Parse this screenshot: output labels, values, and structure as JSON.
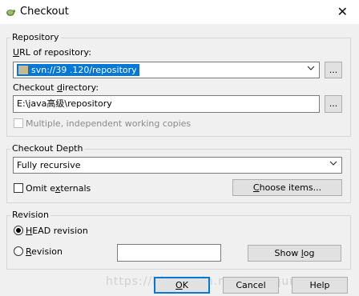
{
  "window": {
    "title": "Checkout",
    "close_glyph": "✕"
  },
  "repository": {
    "group_label": "Repository",
    "url_label_pre": "",
    "url_label_accel": "U",
    "url_label_post": "RL of repository:",
    "url_value": "svn://39            .120/repository",
    "checkout_label_pre": "Checkout ",
    "checkout_label_accel": "d",
    "checkout_label_post": "irectory:",
    "checkout_value": "E:\\java高级\\repository",
    "browse_label": "...",
    "multiple_label": "Multiple, independent working copies"
  },
  "depth": {
    "group_label": "Checkout Depth",
    "value": "Fully recursive",
    "omit_pre": "Omit e",
    "omit_accel": "x",
    "omit_post": "ternals",
    "choose_pre": "",
    "choose_accel": "C",
    "choose_post": "hoose items..."
  },
  "revision": {
    "group_label": "Revision",
    "head_accel": "H",
    "head_post": "EAD revision",
    "rev_accel": "R",
    "rev_post": "evision",
    "rev_value": "",
    "showlog_pre": "Show ",
    "showlog_accel": "l",
    "showlog_post": "og"
  },
  "buttons": {
    "ok_accel": "O",
    "ok_post": "K",
    "cancel": "Cancel",
    "help": "Help"
  },
  "watermark": "https://blog.csdn.net/zengqunge"
}
